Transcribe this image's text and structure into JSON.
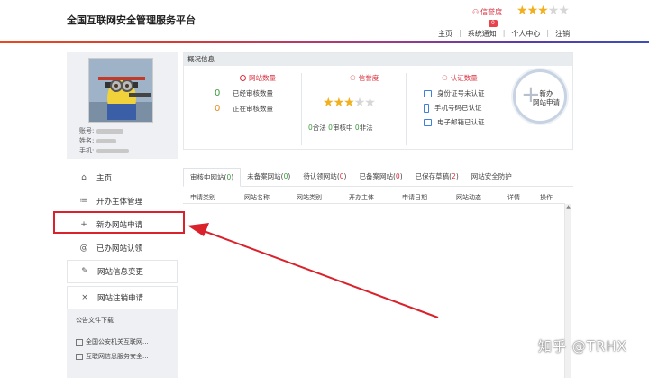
{
  "header": {
    "title": "全国互联网安全管理服务平台",
    "credit_label": "信誉度",
    "credit_badge": "0",
    "credit_stars_filled": 3,
    "credit_stars_total": 5,
    "nav": [
      "主页",
      "系统通知",
      "个人中心",
      "注销"
    ]
  },
  "user": {
    "account_label": "账号:",
    "name_label": "姓名:",
    "phone_label": "手机:"
  },
  "menu": [
    {
      "icon": "home-icon",
      "glyph": "⌂",
      "label": "主页"
    },
    {
      "icon": "list-icon",
      "glyph": "≔",
      "label": "开办主体管理"
    },
    {
      "icon": "plus-icon",
      "glyph": "+",
      "label": "新办网站申请"
    },
    {
      "icon": "at-icon",
      "glyph": "@",
      "label": "已办网站认领"
    },
    {
      "icon": "edit-icon",
      "glyph": "✎",
      "label": "网站信息变更"
    },
    {
      "icon": "close-icon",
      "glyph": "×",
      "label": "网站注销申请"
    }
  ],
  "downloads": {
    "title": "公告文件下载",
    "items": [
      "全国公安机关互联网...",
      "互联网信息服务安全..."
    ]
  },
  "overview": {
    "title": "概况信息",
    "site_count": {
      "title": "网站数量",
      "rows": [
        {
          "value": "0",
          "label": "已经审核数量"
        },
        {
          "value": "0",
          "label": "正在审核数量"
        }
      ]
    },
    "credit": {
      "title": "信誉度",
      "stars_filled": 3,
      "stars_total": 5,
      "legal": "0",
      "legal_label": "合法",
      "reviewing": "0",
      "reviewing_label": "审核中",
      "illegal": "0",
      "illegal_label": "非法"
    },
    "verification": {
      "title": "认证数量",
      "rows": [
        "身份证号未认证",
        "手机号码已认证",
        "电子邮箱已认证"
      ]
    },
    "new_site_button": {
      "line1": "新办",
      "line2": "网站申请"
    }
  },
  "tabs": [
    {
      "label": "审核中网站",
      "count": "0",
      "color": "green",
      "active": true
    },
    {
      "label": "未备案网站",
      "count": "0",
      "color": "green",
      "active": false
    },
    {
      "label": "待认领网站",
      "count": "0",
      "color": "red",
      "active": false
    },
    {
      "label": "已备案网站",
      "count": "0",
      "color": "red",
      "active": false
    },
    {
      "label": "已保存草稿",
      "count": "2",
      "color": "red",
      "active": false
    },
    {
      "label": "网站安全防护",
      "count": "",
      "color": "",
      "active": false
    }
  ],
  "table": {
    "columns": [
      "申请类别",
      "网站名称",
      "网站类别",
      "开办主体",
      "申请日期",
      "网站动态",
      "详情",
      "操作"
    ]
  },
  "watermark": "知乎 @TRHX",
  "colors": {
    "accent_red": "#d9222b",
    "green": "#3a9b3a",
    "star_gold": "#f2b01e"
  }
}
